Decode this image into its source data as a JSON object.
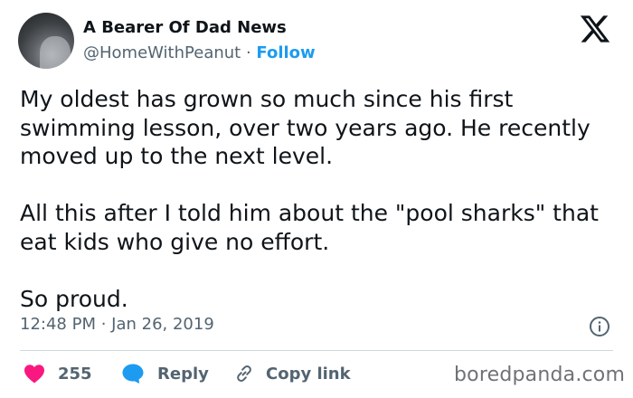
{
  "author": {
    "display_name": "A Bearer Of Dad News",
    "handle": "@HomeWithPeanut",
    "separator": " · ",
    "follow_label": "Follow"
  },
  "post": {
    "text": "My oldest has grown so much since his first\nswimming lesson, over two years ago. He recently\nmoved up to the next level.\n\nAll this after I told him about the \"pool sharks\" that\neat kids who give no effort.\n\nSo proud.",
    "timestamp": "12:48 PM · Jan 26, 2019"
  },
  "actions": {
    "like_count": "255",
    "reply_label": "Reply",
    "copy_link_label": "Copy link"
  },
  "watermark": "boredpanda.com",
  "icons": {
    "logo": "x-logo-icon",
    "like": "heart-icon",
    "reply": "speech-bubble-icon",
    "copy": "link-icon",
    "info": "info-icon"
  },
  "colors": {
    "accent": "#1d9bf0",
    "heart": "#f91880",
    "muted": "#536471",
    "text": "#0f1419"
  }
}
